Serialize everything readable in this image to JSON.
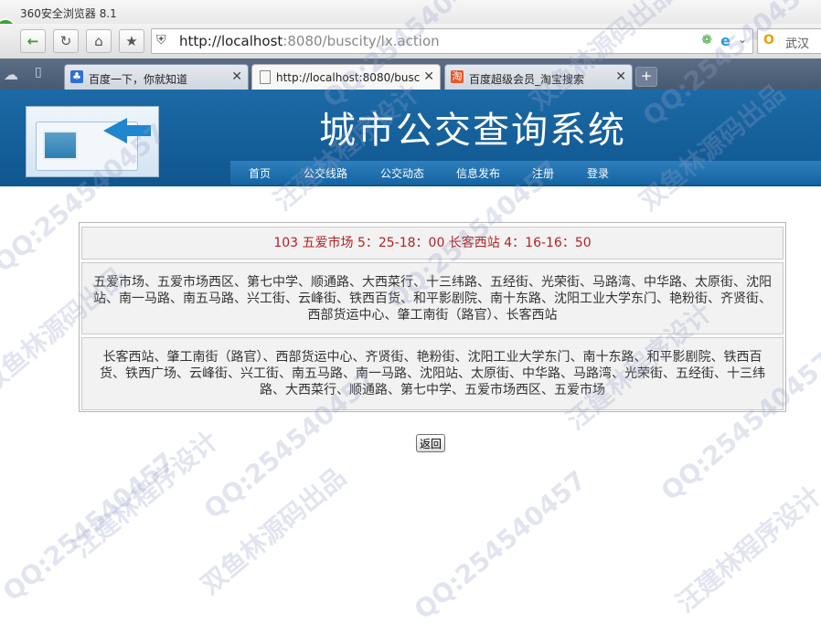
{
  "window": {
    "title": "360安全浏览器 8.1"
  },
  "address_bar": {
    "url_host": "http://localhost",
    "url_rest": ":8080/buscity/lx.action"
  },
  "search_box": {
    "text": "武汉"
  },
  "tabs": [
    {
      "label": "百度一下，你就知道",
      "favicon": "baidu-paw-icon"
    },
    {
      "label": "http://localhost:8080/buscity",
      "favicon": "page-icon"
    },
    {
      "label": "百度超级会员_淘宝搜索",
      "favicon": "taobao-icon"
    }
  ],
  "site": {
    "title": "城市公交查询系统",
    "menu": [
      "首页",
      "公交线路",
      "公交动态",
      "信息发布",
      "注册",
      "登录"
    ]
  },
  "route": {
    "header": "103 五爱市场  5：25-18：00 长客西站  4：16-16：50",
    "forward": "五爱市场、五爱市场西区、第七中学、顺通路、大西菜行、十三纬路、五经街、光荣街、马路湾、中华路、太原街、沈阳站、南一马路、南五马路、兴工街、云峰街、铁西百货、和平影剧院、南十东路、沈阳工业大学东门、艳粉街、齐贤街、西部货运中心、肇工南街（路官）、长客西站",
    "reverse": "长客西站、肇工南街（路官）、西部货运中心、齐贤街、艳粉街、沈阳工业大学东门、南十东路、和平影剧院、铁西百货、铁西广场、云峰街、兴工街、南五马路、南一马路、沈阳站、太原街、中华路、马路湾、光荣街、五经街、十三纬路、大西菜行、顺通路、第七中学、五爱市场西区、五爱市场"
  },
  "buttons": {
    "back": "返回"
  },
  "watermarks": [
    "QQ:254540457",
    "汪建林程序设计",
    "双鱼林源码出品"
  ],
  "colors": {
    "banner": "#1c6aa6",
    "route_header": "#b22222"
  }
}
